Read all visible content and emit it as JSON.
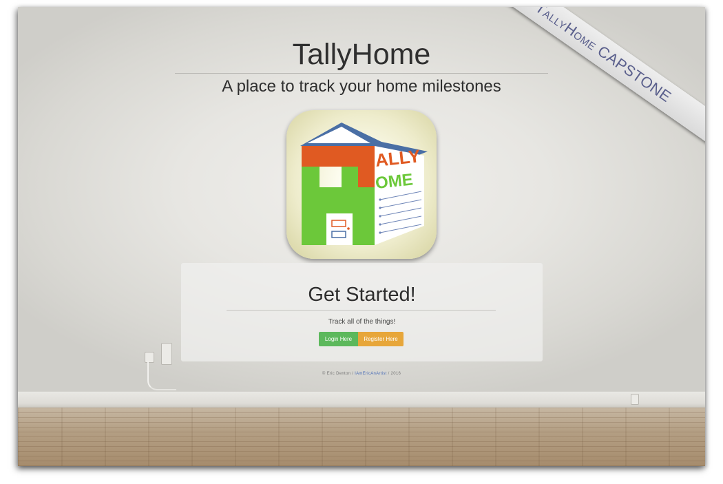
{
  "header": {
    "title": "TallyHome",
    "subtitle": "A place to track your home milestones"
  },
  "ribbon": {
    "text": "TallyHome CAPSTONE"
  },
  "logo": {
    "letters_top": "ALLY",
    "letters_bottom": "OME"
  },
  "get_started": {
    "heading": "Get Started!",
    "tagline": "Track all of the things!",
    "login_label": "Login Here",
    "register_label": "Register Here"
  },
  "footer": {
    "prefix": "© Eric Denton / ",
    "link_text": "IAmEricAnArtist",
    "suffix": " / 2016"
  },
  "colors": {
    "login_button": "#5cb85c",
    "register_button": "#e7a63a",
    "ribbon_text": "#5a5f8c",
    "logo_orange": "#e05a22",
    "logo_green": "#6cc83a",
    "logo_roof": "#4a6fa5"
  }
}
